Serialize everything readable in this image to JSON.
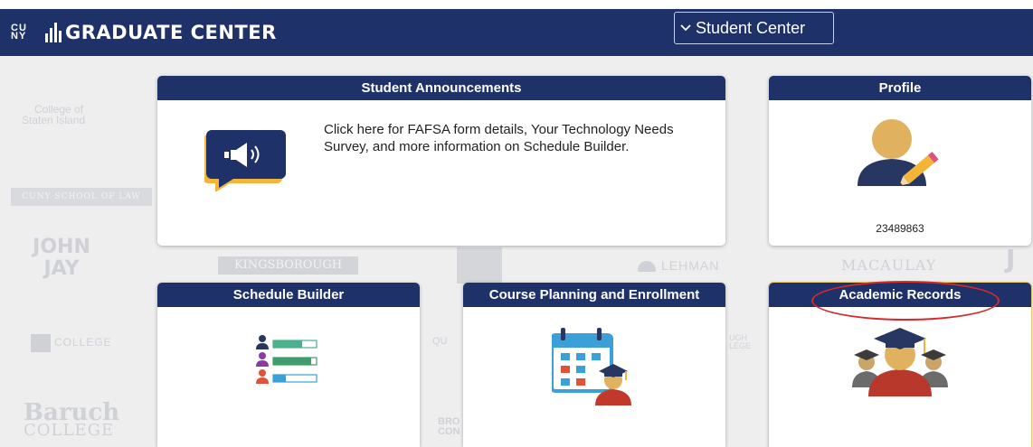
{
  "header": {
    "logo_cuny": "CU NY",
    "logo_text": "GRADUATE CENTER",
    "nav_select": "Student Center"
  },
  "background_logos": {
    "staten_island_1": "College of",
    "staten_island_2": "Staten Island",
    "cuny_law": "CUNY SCHOOL OF LAW",
    "john_jay": "JOHN JAY",
    "kingsborough": "KINGSBOROUGH",
    "lehman": "LEHMAN",
    "macaulay": "MACAULAY",
    "medgar_evers": "COLLEGE",
    "baruch_1": "Baruch",
    "baruch_2": "COLLEGE",
    "bro": "BRO",
    "con": "CON",
    "qu": "QU",
    "ugh": "UGH",
    "lege": "LEGE",
    "jj_right": "J"
  },
  "tiles": {
    "announcements": {
      "title": "Student Announcements",
      "text": "Click here for FAFSA form details, Your Technology Needs Survey, and more information on Schedule Builder."
    },
    "profile": {
      "title": "Profile",
      "id": "23489863"
    },
    "schedule_builder": {
      "title": "Schedule Builder"
    },
    "course_planning": {
      "title": "Course Planning and Enrollment"
    },
    "academic_records": {
      "title": "Academic Records"
    }
  },
  "colors": {
    "banner": "#1e3168",
    "accent_gold": "#f2b53a",
    "annotation_red": "#d42a2a"
  },
  "icons": [
    "megaphone-icon",
    "profile-edit-icon",
    "schedule-list-icon",
    "calendar-graduate-icon",
    "graduates-icon",
    "chevron-down-icon"
  ]
}
